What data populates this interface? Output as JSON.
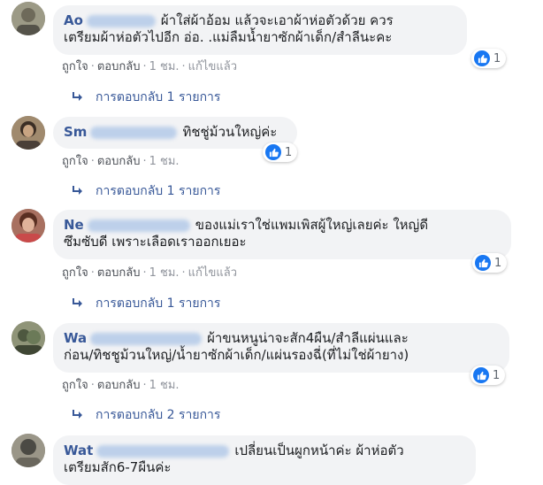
{
  "comments": [
    {
      "name_visible": "Ao",
      "text_line1": "ผ้าใส่ผ้าอ้อม แล้วจะเอาผ้าห่อตัวด้วย ควร",
      "text_line2": "เตรียมผ้าห่อตัวไปอีก อ่อ. .แม่ลืมน้ำยาซักผ้าเด็ก/สำลีนะคะ",
      "like_count": "1",
      "action_like": "ถูกใจ",
      "action_reply": "ตอบกลับ",
      "time": "1 ชม.",
      "edited": "แก้ไขแล้ว",
      "replies_label": "การตอบกลับ 1 รายการ"
    },
    {
      "name_visible": "Sm",
      "text_line1": "ทิชชู่ม้วนใหญ่ค่ะ",
      "like_count": "1",
      "action_like": "ถูกใจ",
      "action_reply": "ตอบกลับ",
      "time": "1 ชม.",
      "replies_label": "การตอบกลับ 1 รายการ"
    },
    {
      "name_visible": "Ne",
      "text_line1": "ของแม่เราใช่แพมเพิสผู้ใหญ่เลยค่ะ ใหญ่ดี",
      "text_line2": "ซึมซับดี เพราะเลือดเราออกเยอะ",
      "like_count": "1",
      "action_like": "ถูกใจ",
      "action_reply": "ตอบกลับ",
      "time": "1 ชม.",
      "edited": "แก้ไขแล้ว",
      "replies_label": "การตอบกลับ 1 รายการ"
    },
    {
      "name_visible": "Wa",
      "text_line1": "ผ้าขนหนูน่าจะสัก4ผืน/สำลีแผ่นและ",
      "text_line2": "ก่อน/ทิชชูม้วนใหญ่/น้ำยาซักผ้าเด็ก/แผ่นรองฉี่(ที่ไม่ใช่ผ้ายาง)",
      "like_count": "1",
      "action_like": "ถูกใจ",
      "action_reply": "ตอบกลับ",
      "time": "1 ชม.",
      "replies_label": "การตอบกลับ 2 รายการ"
    },
    {
      "name_visible": "Wat",
      "text_line1": "เปลี่ยนเป็นผูกหน้าค่ะ ผ้าห่อตัว",
      "text_line2": "เตรียมสัก6-7ผืนค่ะ"
    }
  ],
  "colors": {
    "name_link": "#385898",
    "bubble_bg": "#f2f3f5",
    "like_blue": "#1877f2"
  },
  "icons": [
    "like-thumb-icon",
    "reply-arrow-icon"
  ]
}
